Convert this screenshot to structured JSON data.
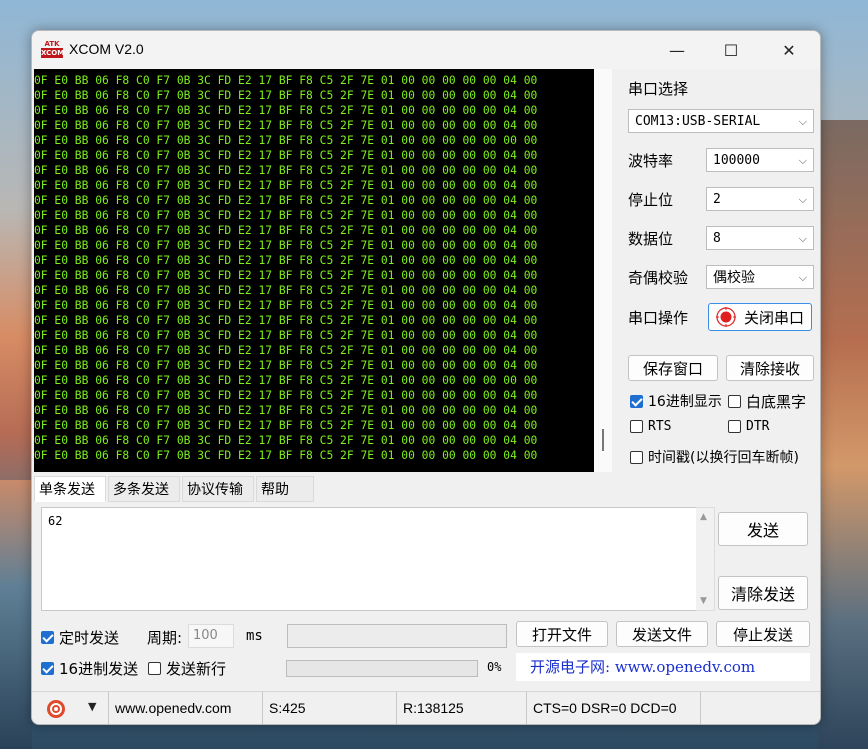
{
  "window": {
    "title": "XCOM V2.0",
    "logo_top": "ATK",
    "logo_bottom": "XCOM"
  },
  "titlebar_buttons": {
    "minimize": "—",
    "maximize": "☐",
    "close": "✕"
  },
  "receive": {
    "lines": [
      "0F E0 BB 06 F8 C0 F7 0B 3C FD E2 17 BF F8 C5 2F 7E 01 00 00 00 00 00 04 00",
      "0F E0 BB 06 F8 C0 F7 0B 3C FD E2 17 BF F8 C5 2F 7E 01 00 00 00 00 00 04 00",
      "0F E0 BB 06 F8 C0 F7 0B 3C FD E2 17 BF F8 C5 2F 7E 01 00 00 00 00 00 04 00",
      "0F E0 BB 06 F8 C0 F7 0B 3C FD E2 17 BF F8 C5 2F 7E 01 00 00 00 00 00 04 00",
      "0F E0 BB 06 F8 C0 F7 0B 3C FD E2 17 BF F8 C5 2F 7E 01 00 00 00 00 00 00 00",
      "0F E0 BB 06 F8 C0 F7 0B 3C FD E2 17 BF F8 C5 2F 7E 01 00 00 00 00 00 04 00",
      "0F E0 BB 06 F8 C0 F7 0B 3C FD E2 17 BF F8 C5 2F 7E 01 00 00 00 00 00 04 00",
      "0F E0 BB 06 F8 C0 F7 0B 3C FD E2 17 BF F8 C5 2F 7E 01 00 00 00 00 00 04 00",
      "0F E0 BB 06 F8 C0 F7 0B 3C FD E2 17 BF F8 C5 2F 7E 01 00 00 00 00 00 04 00",
      "0F E0 BB 06 F8 C0 F7 0B 3C FD E2 17 BF F8 C5 2F 7E 01 00 00 00 00 00 04 00",
      "0F E0 BB 06 F8 C0 F7 0B 3C FD E2 17 BF F8 C5 2F 7E 01 00 00 00 00 00 04 00",
      "0F E0 BB 06 F8 C0 F7 0B 3C FD E2 17 BF F8 C5 2F 7E 01 00 00 00 00 00 04 00",
      "0F E0 BB 06 F8 C0 F7 0B 3C FD E2 17 BF F8 C5 2F 7E 01 00 00 00 00 00 04 00",
      "0F E0 BB 06 F8 C0 F7 0B 3C FD E2 17 BF F8 C5 2F 7E 01 00 00 00 00 00 04 00",
      "0F E0 BB 06 F8 C0 F7 0B 3C FD E2 17 BF F8 C5 2F 7E 01 00 00 00 00 00 04 00",
      "0F E0 BB 06 F8 C0 F7 0B 3C FD E2 17 BF F8 C5 2F 7E 01 00 00 00 00 00 04 00",
      "0F E0 BB 06 F8 C0 F7 0B 3C FD E2 17 BF F8 C5 2F 7E 01 00 00 00 00 00 04 00",
      "0F E0 BB 06 F8 C0 F7 0B 3C FD E2 17 BF F8 C5 2F 7E 01 00 00 00 00 00 04 00",
      "0F E0 BB 06 F8 C0 F7 0B 3C FD E2 17 BF F8 C5 2F 7E 01 00 00 00 00 00 04 00",
      "0F E0 BB 06 F8 C0 F7 0B 3C FD E2 17 BF F8 C5 2F 7E 01 00 00 00 00 00 04 00",
      "0F E0 BB 06 F8 C0 F7 0B 3C FD E2 17 BF F8 C5 2F 7E 01 00 00 00 00 00 00 00",
      "0F E0 BB 06 F8 C0 F7 0B 3C FD E2 17 BF F8 C5 2F 7E 01 00 00 00 00 00 04 00",
      "0F E0 BB 06 F8 C0 F7 0B 3C FD E2 17 BF F8 C5 2F 7E 01 00 00 00 00 00 04 00",
      "0F E0 BB 06 F8 C0 F7 0B 3C FD E2 17 BF F8 C5 2F 7E 01 00 00 00 00 00 04 00",
      "0F E0 BB 06 F8 C0 F7 0B 3C FD E2 17 BF F8 C5 2F 7E 01 00 00 00 00 00 04 00",
      "0F E0 BB 06 F8 C0 F7 0B 3C FD E2 17 BF F8 C5 2F 7E 01 00 00 00 00 00 04 00"
    ]
  },
  "serial": {
    "port_label": "串口选择",
    "port_value": "COM13:USB-SERIAL",
    "baud_label": "波特率",
    "baud_value": "100000",
    "stop_label": "停止位",
    "stop_value": "2",
    "data_label": "数据位",
    "data_value": "8",
    "parity_label": "奇偶校验",
    "parity_value": "偶校验",
    "op_label": "串口操作",
    "op_button": "关闭串口"
  },
  "buttons": {
    "save_window": "保存窗口",
    "clear_receive": "清除接收",
    "send": "发送",
    "clear_send": "清除发送",
    "open_file": "打开文件",
    "send_file": "发送文件",
    "stop_send": "停止发送"
  },
  "options": {
    "hex_display": "16进制显示",
    "white_bg": "白底黑字",
    "rts": "RTS",
    "dtr": "DTR",
    "timestamp": "时间戳(以换行回车断帧)"
  },
  "tabs": [
    "单条发送",
    "多条发送",
    "协议传输",
    "帮助"
  ],
  "send_text": "62",
  "bottom": {
    "timed_send": "定时发送",
    "period_label": "周期:",
    "period_value": "100",
    "period_unit": "ms",
    "hex_send": "16进制发送",
    "send_newline": "发送新行",
    "progress_text": "0%"
  },
  "banner": "开源电子网: www.openedv.com",
  "status": {
    "url": "www.openedv.com",
    "sent": "S:425",
    "received": "R:138125",
    "lines": "CTS=0 DSR=0 DCD=0"
  },
  "colors": {
    "recv_bg": "#000000",
    "recv_fg": "#7ef01d",
    "banner_text": "#1a2fd0",
    "led": "#e02020"
  }
}
